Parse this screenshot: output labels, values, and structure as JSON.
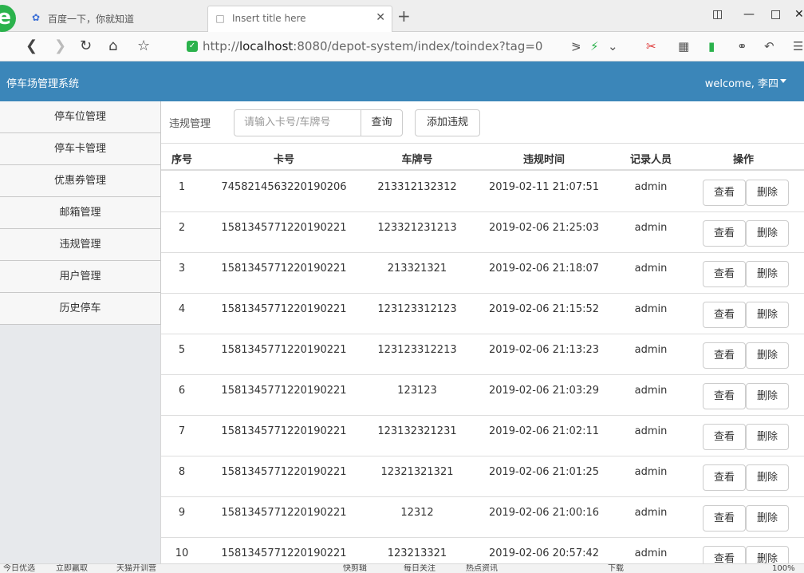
{
  "browser": {
    "tabs": [
      {
        "label": "百度一下，你就知道",
        "icon": "paw-icon"
      },
      {
        "label": "Insert title here",
        "icon": "page-icon"
      }
    ],
    "url_prefix": "http://",
    "url_host": "localhost",
    "url_rest": ":8080/depot-system/index/toindex?tag=0",
    "logo_letter": "e"
  },
  "app": {
    "title": "停车场管理系统",
    "welcome": "welcome, 李四"
  },
  "sidebar": {
    "items": [
      {
        "label": "停车位管理"
      },
      {
        "label": "停车卡管理"
      },
      {
        "label": "优惠券管理"
      },
      {
        "label": "邮箱管理"
      },
      {
        "label": "违规管理"
      },
      {
        "label": "用户管理"
      },
      {
        "label": "历史停车"
      }
    ]
  },
  "toolbar": {
    "label": "违规管理",
    "search_placeholder": "请输入卡号/车牌号",
    "search_button": "查询",
    "add_button": "添加违规"
  },
  "table": {
    "headers": [
      "序号",
      "卡号",
      "车牌号",
      "违规时间",
      "记录人员",
      "操作"
    ],
    "view_label": "查看",
    "delete_label": "删除",
    "rows": [
      {
        "idx": "1",
        "card": "7458214563220190206",
        "plate": "213312132312",
        "time": "2019-02-11 21:07:51",
        "user": "admin"
      },
      {
        "idx": "2",
        "card": "1581345771220190221",
        "plate": "123321231213",
        "time": "2019-02-06 21:25:03",
        "user": "admin"
      },
      {
        "idx": "3",
        "card": "1581345771220190221",
        "plate": "213321321",
        "time": "2019-02-06 21:18:07",
        "user": "admin"
      },
      {
        "idx": "4",
        "card": "1581345771220190221",
        "plate": "123123312123",
        "time": "2019-02-06 21:15:52",
        "user": "admin"
      },
      {
        "idx": "5",
        "card": "1581345771220190221",
        "plate": "123123312213",
        "time": "2019-02-06 21:13:23",
        "user": "admin"
      },
      {
        "idx": "6",
        "card": "1581345771220190221",
        "plate": "123123",
        "time": "2019-02-06 21:03:29",
        "user": "admin"
      },
      {
        "idx": "7",
        "card": "1581345771220190221",
        "plate": "123132321231",
        "time": "2019-02-06 21:02:11",
        "user": "admin"
      },
      {
        "idx": "8",
        "card": "1581345771220190221",
        "plate": "12321321321",
        "time": "2019-02-06 21:01:25",
        "user": "admin"
      },
      {
        "idx": "9",
        "card": "1581345771220190221",
        "plate": "12312",
        "time": "2019-02-06 21:00:16",
        "user": "admin"
      },
      {
        "idx": "10",
        "card": "1581345771220190221",
        "plate": "123213321",
        "time": "2019-02-06 20:57:42",
        "user": "admin"
      }
    ]
  },
  "statusbar": {
    "items": [
      "今日优选",
      "立即赢取",
      "天猫开训营",
      "快剪辑",
      "每日关注",
      "热点资讯",
      "下载",
      "100%"
    ]
  },
  "colors": {
    "header_bg": "#3b86b9",
    "sidebar_bg": "#e7e9ec",
    "logo_green": "#2bb24c"
  }
}
